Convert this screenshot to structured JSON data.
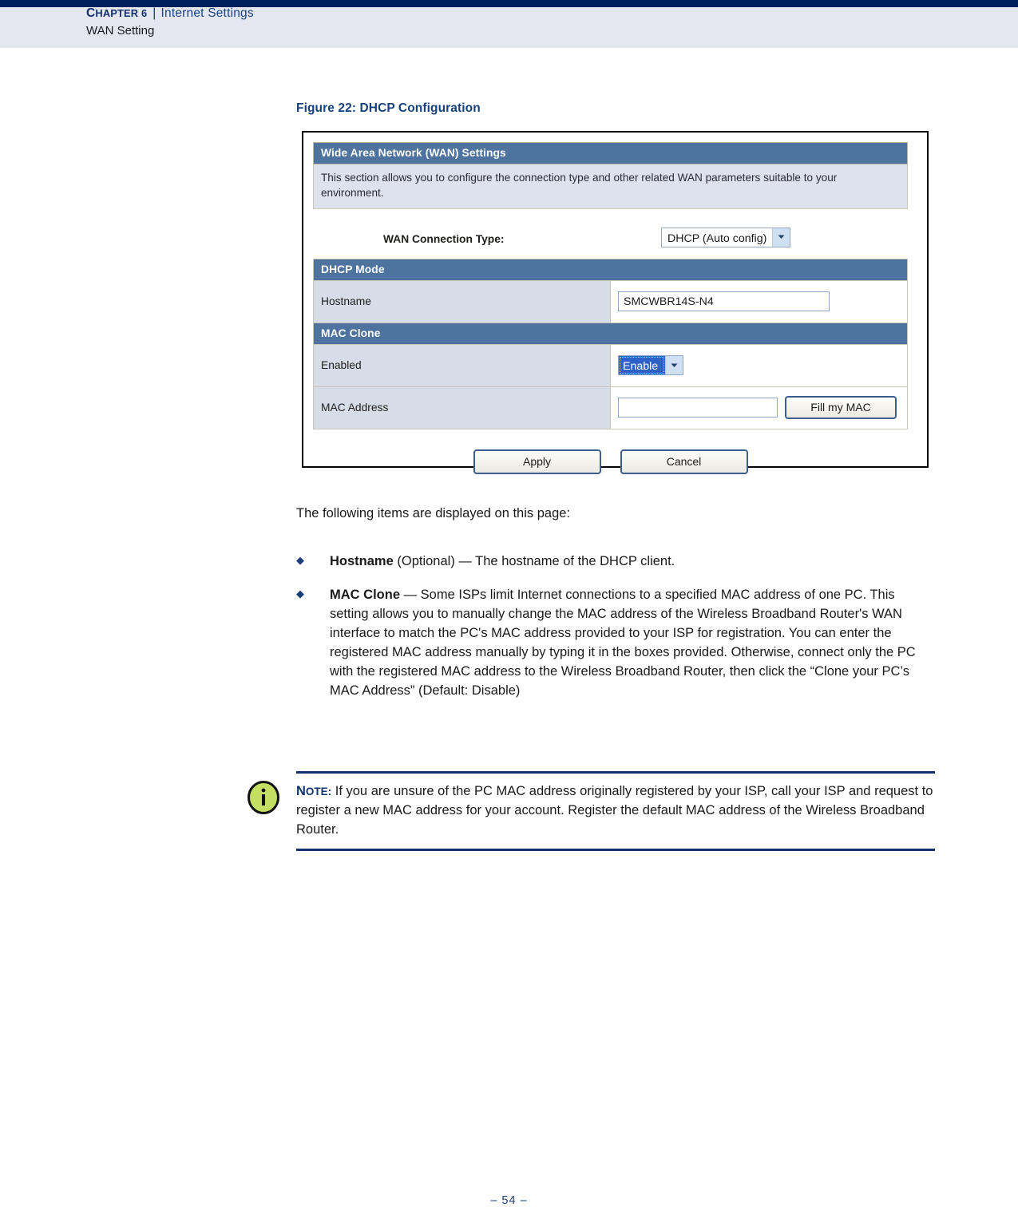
{
  "header": {
    "chapter_label": "Chapter 6",
    "chapter_label_small": "HAPTER 6",
    "separator": "|",
    "chapter_title": "Internet Settings",
    "section_title": "WAN Setting"
  },
  "figure": {
    "caption": "Figure 22:  DHCP Configuration",
    "panel_title": "Wide Area Network (WAN) Settings",
    "panel_description": "This section allows you to configure the connection type and other related WAN parameters suitable to your environment.",
    "connection_type_label": "WAN Connection Type:",
    "connection_type_value": "DHCP (Auto config)",
    "dhcp_mode_heading": "DHCP Mode",
    "hostname_label": "Hostname",
    "hostname_value": "SMCWBR14S-N4",
    "mac_clone_heading": "MAC Clone",
    "enabled_label": "Enabled",
    "enabled_value": "Enable",
    "mac_address_label": "MAC Address",
    "mac_address_value": "",
    "fill_my_mac_label": "Fill my MAC",
    "apply_label": "Apply",
    "cancel_label": "Cancel",
    "colors": {
      "section_bar": "#4d739e",
      "label_cell": "#d7dde8",
      "description_bg": "#dde2ec",
      "selected_highlight": "#2f62c8"
    }
  },
  "body": {
    "intro": "The following items are displayed on this page:",
    "bullet_marker": "◆",
    "bullets": [
      {
        "term": "Hostname",
        "rest": " (Optional) — The hostname of the DHCP client."
      },
      {
        "term": "MAC Clone",
        "rest": " — Some ISPs limit Internet connections to a specified MAC address of one PC. This setting allows you to manually change the MAC address of the Wireless Broadband Router's WAN interface to match the PC's MAC address provided to your ISP for registration. You can enter the registered MAC address manually by typing it in the boxes provided. Otherwise, connect only the PC with the registered MAC address to the Wireless Broadband Router, then click the “Clone your PC’s MAC Address” (Default: Disable)"
      }
    ]
  },
  "note": {
    "label": "Note:",
    "label_cap": "N",
    "label_small": "OTE:",
    "text": " If you are unsure of the PC MAC address originally registered by your ISP, call your ISP and request to register a new MAC address for your account. Register the default MAC address of the Wireless Broadband Router.",
    "icon_letter": "i",
    "icon_fill": "#c3de63",
    "rule_color": "#12336b"
  },
  "footer": {
    "page_number": "–   54   –"
  }
}
